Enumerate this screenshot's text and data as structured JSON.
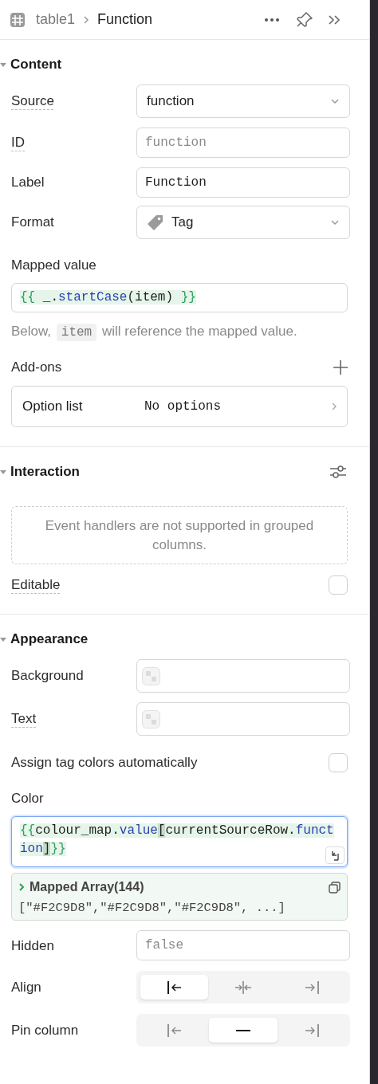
{
  "header": {
    "parent": "table1",
    "title": "Function"
  },
  "sections": [
    {
      "title": "Content",
      "expanded": true,
      "settings_button": false,
      "rows": [
        {
          "kind": "select",
          "label": "Source",
          "value": "function",
          "hint": true,
          "tag_icon": false
        },
        {
          "kind": "input",
          "label": "ID",
          "placeholder": "function",
          "hint": true
        },
        {
          "kind": "input",
          "label": "Label",
          "value": "Function",
          "hint": false
        },
        {
          "kind": "select",
          "label": "Format",
          "value": "Tag",
          "hint": false,
          "tag_icon": true
        },
        {
          "kind": "code",
          "label": "Mapped value",
          "focused": false,
          "tokens": [
            {
              "text": "{{ ",
              "kind": "brace"
            },
            {
              "text": "_.",
              "kind": "plain"
            },
            {
              "text": "startCase",
              "kind": "prop"
            },
            {
              "text": "(item)",
              "kind": "plain"
            },
            {
              "text": " }}",
              "kind": "brace"
            }
          ]
        },
        {
          "kind": "note",
          "before": "Below, ",
          "code": "item",
          "after": " will reference the mapped value."
        },
        {
          "kind": "addons",
          "label": "Add-ons",
          "items": [
            {
              "label": "Option list",
              "value": "No options"
            }
          ]
        }
      ]
    },
    {
      "title": "Interaction",
      "expanded": true,
      "settings_button": true,
      "rows": [
        {
          "kind": "notice",
          "text": "Event handlers are not supported in grouped columns."
        },
        {
          "kind": "checkbox",
          "label": "Editable",
          "checked": false,
          "hint": true
        }
      ]
    },
    {
      "title": "Appearance",
      "expanded": true,
      "settings_button": false,
      "rows": [
        {
          "kind": "color",
          "label": "Background",
          "hint": false
        },
        {
          "kind": "color",
          "label": "Text",
          "hint": true
        },
        {
          "kind": "checkbox",
          "label": "Assign tag colors automatically",
          "checked": false,
          "hint": false
        },
        {
          "kind": "code",
          "label": "Color",
          "focused": true,
          "tokens": [
            {
              "text": "{{",
              "kind": "brace"
            },
            {
              "text": "colour_map.",
              "kind": "plain"
            },
            {
              "text": "value",
              "kind": "prop"
            },
            {
              "text": "[",
              "kind": "bracket"
            },
            {
              "text": "currentSourceRow.",
              "kind": "plain"
            },
            {
              "text": "function",
              "kind": "prop"
            },
            {
              "text": "]",
              "kind": "bracket"
            },
            {
              "text": "}}",
              "kind": "brace"
            }
          ],
          "preview": {
            "title": "Mapped Array(144)",
            "value": "[\"#F2C9D8\",\"#F2C9D8\",\"#F2C9D8\", ...]"
          }
        },
        {
          "kind": "input",
          "label": "Hidden",
          "placeholder": "false",
          "hint": false
        },
        {
          "kind": "segmented",
          "label": "Align",
          "options": [
            {
              "kind": "left",
              "selected": true
            },
            {
              "kind": "center",
              "selected": false
            },
            {
              "kind": "right",
              "selected": false
            }
          ]
        },
        {
          "kind": "segmented",
          "label": "Pin column",
          "options": [
            {
              "kind": "pin-left",
              "selected": false
            },
            {
              "kind": "none",
              "selected": true
            },
            {
              "kind": "pin-right",
              "selected": false
            }
          ]
        }
      ]
    }
  ]
}
